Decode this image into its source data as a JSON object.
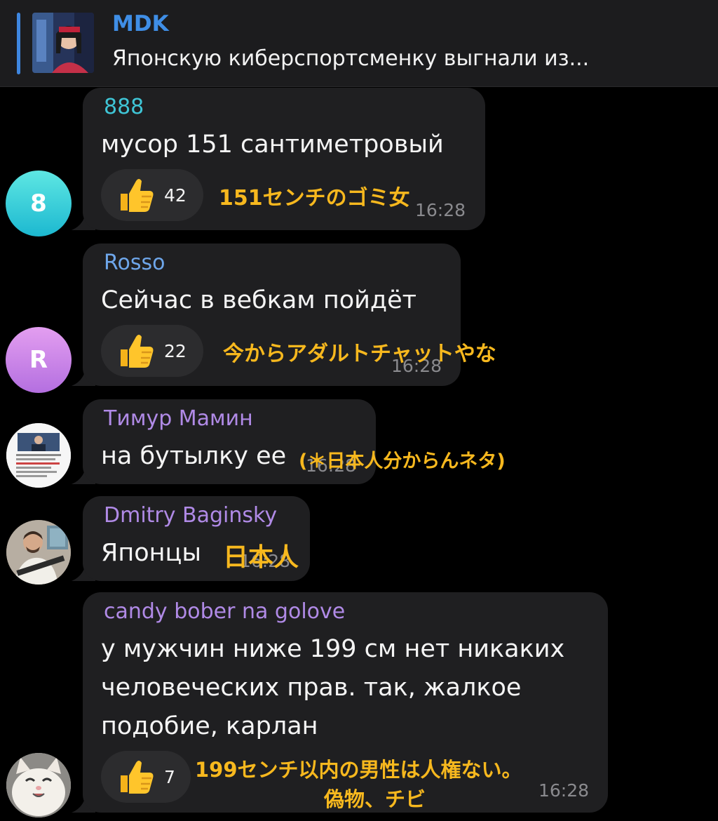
{
  "pinned": {
    "title": "MDK",
    "text": "Японскую киберспортсменку выгнали из..."
  },
  "messages": [
    {
      "sender": "888",
      "sender_color": "#3fc5d6",
      "avatar_letter": "8",
      "text": "мусор 151 сантиметровый",
      "reaction_count": "42",
      "time": "16:28",
      "translation": "151センチのゴミ女"
    },
    {
      "sender": "Rosso",
      "sender_color": "#6ea6ea",
      "avatar_letter": "R",
      "text": "Сейчас в вебкам пойдёт",
      "reaction_count": "22",
      "time": "16:28",
      "translation": "今からアダルトチャットやな"
    },
    {
      "sender": "Тимур Мамин",
      "sender_color": "#b08ae6",
      "text": "на бутылку ее",
      "time": "16:28",
      "translation": "(＊日本人分からんネタ)"
    },
    {
      "sender": "Dmitry Baginsky",
      "sender_color": "#b08ae6",
      "text": "Японцы",
      "time": "16:28",
      "translation": "日本人"
    },
    {
      "sender": "candy bober na golove",
      "sender_color": "#b08ae6",
      "text_lines": [
        "у мужчин ниже 199 см нет никаких",
        "человеческих прав. так, жалкое",
        "подобие, карлан"
      ],
      "reaction_count": "7",
      "time": "16:28",
      "translation_lines": [
        "199センチ以内の男性は人権ない。",
        "偽物、チビ"
      ]
    }
  ],
  "colors": {
    "bubble": "#1f1f21",
    "translation": "#f7b81e",
    "pin_accent": "#3e86e0"
  }
}
